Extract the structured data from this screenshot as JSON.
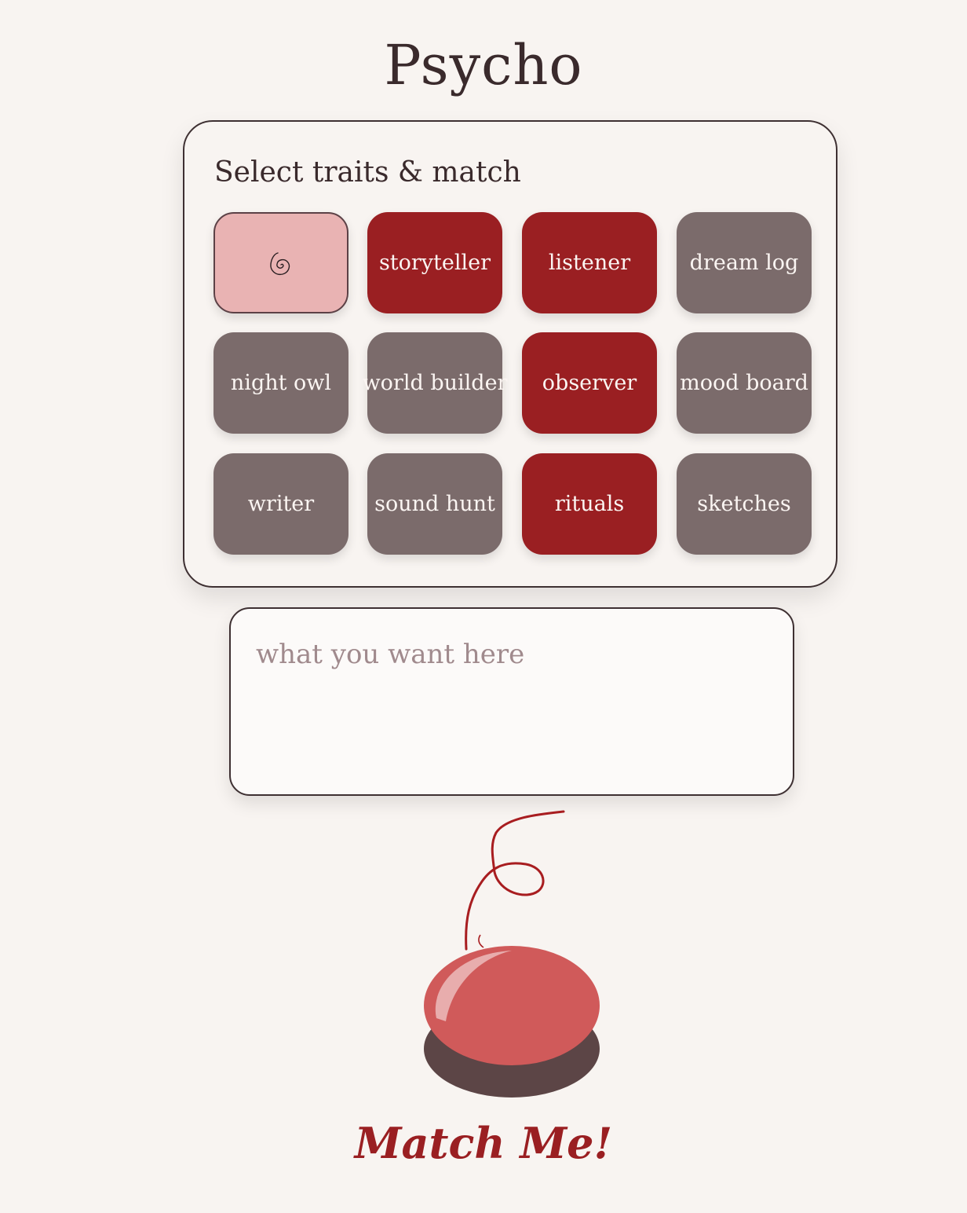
{
  "app": {
    "title": "Psycho"
  },
  "panel": {
    "heading": "Select traits & match",
    "tiles": [
      {
        "label": "",
        "icon": "spiral-icon",
        "state": "selected"
      },
      {
        "label": "storyteller",
        "state": "active"
      },
      {
        "label": "listener",
        "state": "active"
      },
      {
        "label": "dream log",
        "state": "inactive"
      },
      {
        "label": "night owl",
        "state": "inactive"
      },
      {
        "label": "world builder",
        "state": "inactive"
      },
      {
        "label": "observer",
        "state": "active"
      },
      {
        "label": "mood board",
        "state": "inactive"
      },
      {
        "label": "writer",
        "state": "inactive"
      },
      {
        "label": "sound hunt",
        "state": "inactive"
      },
      {
        "label": "rituals",
        "state": "active"
      },
      {
        "label": "sketches",
        "state": "inactive"
      }
    ]
  },
  "input": {
    "placeholder": "what you want here",
    "value": ""
  },
  "match_button": {
    "label": "Match Me!"
  },
  "colors": {
    "background": "#f8f4f1",
    "active": "#9a1f22",
    "inactive": "#7b6b6b",
    "selected": "#e9b3b3",
    "button_top": "#d05a5a",
    "button_base": "#5c4546"
  }
}
